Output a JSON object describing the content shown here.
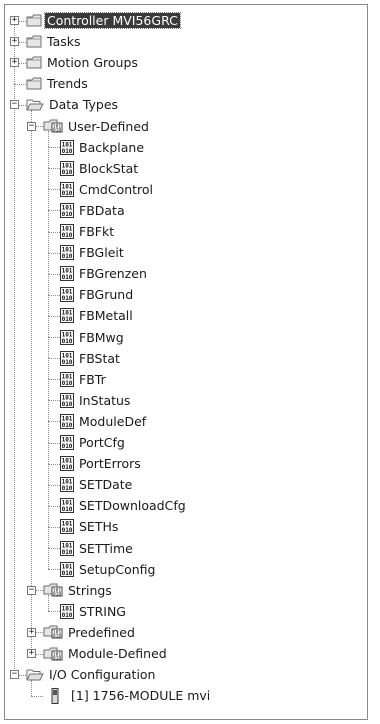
{
  "tree": {
    "root_items": [
      {
        "label": "Controller MVI56GRC",
        "icon": "folder-icon",
        "toggle": "+",
        "selected": true
      },
      {
        "label": "Tasks",
        "icon": "folder-icon",
        "toggle": "+"
      },
      {
        "label": "Motion Groups",
        "icon": "folder-icon",
        "toggle": "+"
      },
      {
        "label": "Trends",
        "icon": "folder-icon",
        "toggle": ""
      },
      {
        "label": "Data Types",
        "icon": "open-folder-icon",
        "toggle": "−"
      }
    ],
    "user_defined": {
      "label": "User-Defined",
      "icon": "datatype-folder-icon",
      "toggle": "−",
      "items": [
        "Backplane",
        "BlockStat",
        "CmdControl",
        "FBData",
        "FBFkt",
        "FBGleit",
        "FBGrenzen",
        "FBGrund",
        "FBMetall",
        "FBMwg",
        "FBStat",
        "FBTr",
        "InStatus",
        "ModuleDef",
        "PortCfg",
        "PortErrors",
        "SETDate",
        "SETDownloadCfg",
        "SETHs",
        "SETTime",
        "SetupConfig"
      ]
    },
    "strings": {
      "label": "Strings",
      "icon": "datatype-folder-icon",
      "toggle": "−",
      "items": [
        "STRING"
      ]
    },
    "predefined": {
      "label": "Predefined",
      "icon": "datatype-folder-icon",
      "toggle": "+"
    },
    "module_defined": {
      "label": "Module-Defined",
      "icon": "datatype-folder-icon",
      "toggle": "+"
    },
    "io_configuration": {
      "label": "I/O Configuration",
      "icon": "open-folder-icon",
      "toggle": "−"
    },
    "module": {
      "label": "[1] 1756-MODULE mvi",
      "icon": "module-icon"
    }
  },
  "datatype_icon_text": [
    "101",
    "010"
  ]
}
